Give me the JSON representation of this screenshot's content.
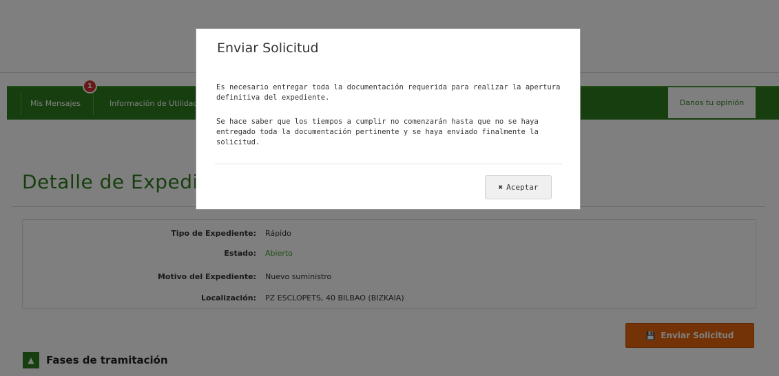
{
  "nav": {
    "messages_label": "Mis Mensajes",
    "messages_badge": "1",
    "info_label": "Información de Utilidad",
    "opinion_label": "Danos tu opinión"
  },
  "page": {
    "title": "Detalle de Expediente"
  },
  "details": [
    {
      "label": "Tipo de Expediente:",
      "value": "Rápido"
    },
    {
      "label": "Estado:",
      "value": "Abierto"
    },
    {
      "label": "Motivo del Expediente:",
      "value": "Nuevo suministro"
    },
    {
      "label": "Localización:",
      "value": "PZ ESCLOPETS, 40 BILBAO (BIZKAIA)"
    }
  ],
  "actions": {
    "send_label": "Enviar Solicitud",
    "send_icon": "save-icon"
  },
  "section": {
    "phases_label": "Fases de tramitación",
    "phases_icon": "chevron-up-icon"
  },
  "modal": {
    "title": "Enviar Solicitud",
    "paragraph1": "Es necesario entregar toda la documentación requerida para realizar la apertura definitiva del expediente.",
    "paragraph2": "Se hace saber que los tiempos a cumplir no comenzarán hasta que no se haya entregado toda la documentación pertinente y se haya enviado finalmente la solicitud.",
    "accept_label": "Aceptar",
    "accept_icon": "close-icon"
  },
  "colors": {
    "brand_green": "#2e7d1f",
    "status_green": "#3f9a2a",
    "accent_orange": "#e8670c",
    "badge_red": "#d32f2f"
  }
}
